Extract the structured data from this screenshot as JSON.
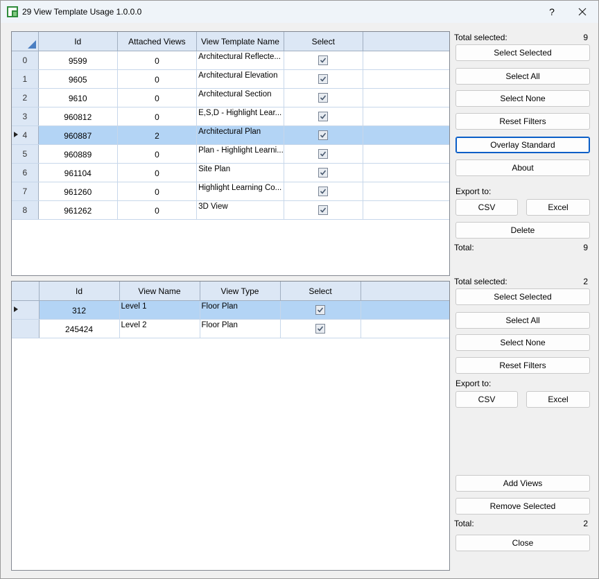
{
  "window": {
    "title": "29 View Template Usage 1.0.0.0",
    "help_label": "?"
  },
  "templates_grid": {
    "columns": [
      "Id",
      "Attached Views",
      "View Template Name",
      "Select"
    ],
    "rows": [
      {
        "index": "0",
        "id": "9599",
        "attached": "0",
        "name": "Architectural Reflecte...",
        "checked": true
      },
      {
        "index": "1",
        "id": "9605",
        "attached": "0",
        "name": "Architectural Elevation",
        "checked": true
      },
      {
        "index": "2",
        "id": "9610",
        "attached": "0",
        "name": "Architectural Section",
        "checked": true
      },
      {
        "index": "3",
        "id": "960812",
        "attached": "0",
        "name": "E,S,D - Highlight Lear...",
        "checked": true
      },
      {
        "index": "4",
        "id": "960887",
        "attached": "2",
        "name": "Architectural Plan",
        "checked": true,
        "selected": true
      },
      {
        "index": "5",
        "id": "960889",
        "attached": "0",
        "name": "Plan - Highlight Learni...",
        "checked": true
      },
      {
        "index": "6",
        "id": "961104",
        "attached": "0",
        "name": "Site Plan",
        "checked": true
      },
      {
        "index": "7",
        "id": "961260",
        "attached": "0",
        "name": "Highlight Learning Co...",
        "checked": true
      },
      {
        "index": "8",
        "id": "961262",
        "attached": "0",
        "name": "3D View",
        "checked": true
      }
    ]
  },
  "views_grid": {
    "columns": [
      "Id",
      "View Name",
      "View Type",
      "Select"
    ],
    "rows": [
      {
        "id": "312",
        "name": "Level 1",
        "type": "Floor Plan",
        "checked": true,
        "selected": true
      },
      {
        "id": "245424",
        "name": "Level 2",
        "type": "Floor Plan",
        "checked": true
      }
    ]
  },
  "top_panel": {
    "total_selected_label": "Total selected:",
    "total_selected_value": "9",
    "select_selected": "Select Selected",
    "select_all": "Select All",
    "select_none": "Select None",
    "reset_filters": "Reset Filters",
    "overlay_standard": "Overlay Standard",
    "about": "About",
    "export_label": "Export to:",
    "csv": "CSV",
    "excel": "Excel",
    "delete": "Delete",
    "total_label": "Total:",
    "total_value": "9"
  },
  "bottom_panel": {
    "total_selected_label": "Total selected:",
    "total_selected_value": "2",
    "select_selected": "Select Selected",
    "select_all": "Select All",
    "select_none": "Select None",
    "reset_filters": "Reset Filters",
    "export_label": "Export to:",
    "csv": "CSV",
    "excel": "Excel",
    "add_views": "Add Views",
    "remove_selected": "Remove Selected",
    "total_label": "Total:",
    "total_value": "2",
    "close": "Close"
  }
}
